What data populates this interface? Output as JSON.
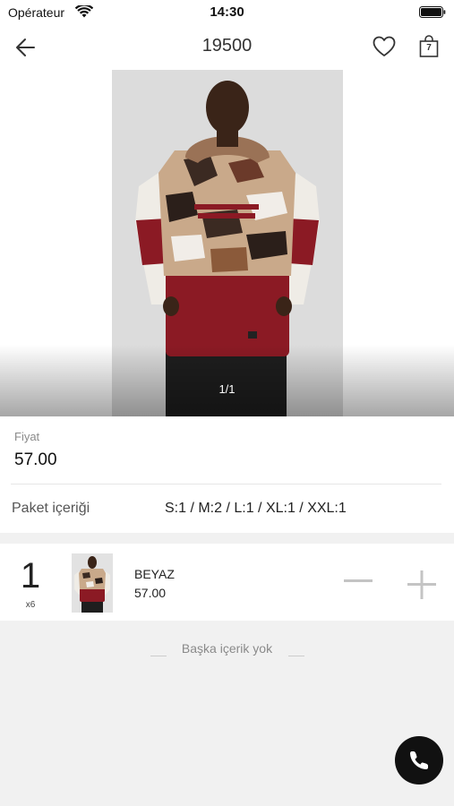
{
  "status_bar": {
    "carrier": "Opérateur",
    "time": "14:30"
  },
  "nav": {
    "title": "19500",
    "cart_count": "7"
  },
  "gallery": {
    "counter": "1/1"
  },
  "price": {
    "label": "Fiyat",
    "value": "57.00"
  },
  "package": {
    "label": "Paket içeriği",
    "value": "S:1 / M:2 / L:1 / XL:1 / XXL:1"
  },
  "variant": {
    "quantity": "1",
    "multiplier": "x6",
    "color": "BEYAZ",
    "price": "57.00"
  },
  "footer": {
    "no_more_text": "Başka içerik yok"
  },
  "icons": {
    "back": "arrow-left-icon",
    "favorite": "heart-icon",
    "cart": "shopping-bag-icon",
    "decrease": "minus-icon",
    "increase": "plus-icon",
    "call": "phone-icon"
  },
  "colors": {
    "accent": "#111111",
    "background": "#f1f1f1",
    "muted_text": "#8a8a8a",
    "hoodie_red": "#8b1a24"
  }
}
